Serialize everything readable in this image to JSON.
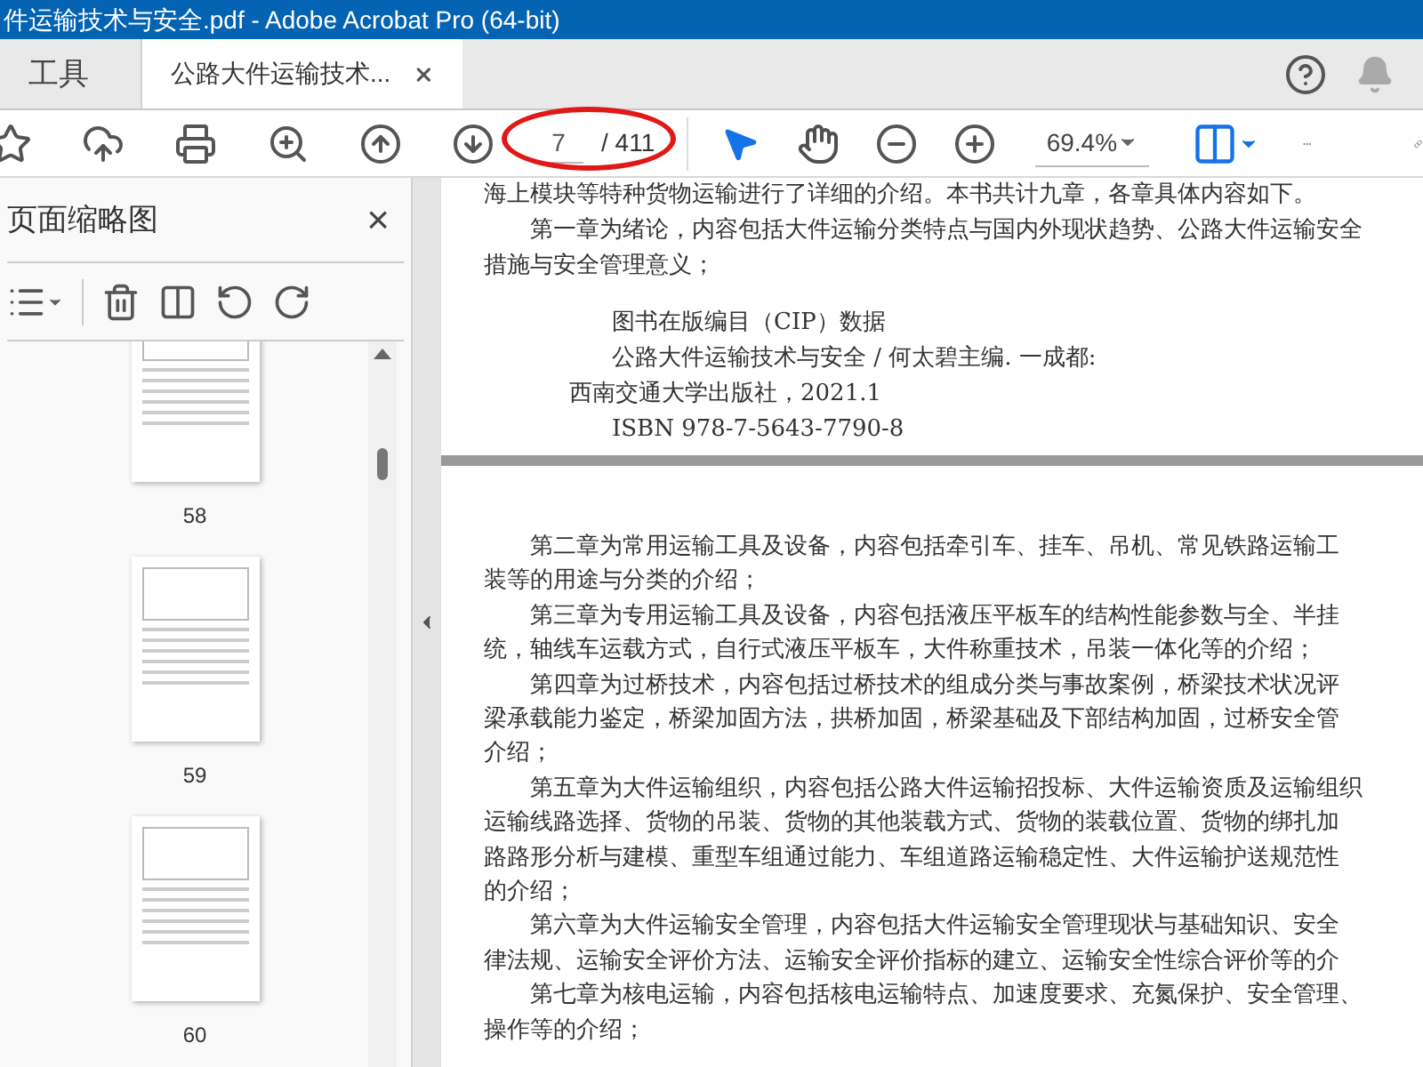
{
  "window": {
    "title": "件运输技术与安全.pdf - Adobe Acrobat Pro (64-bit)"
  },
  "tabs": [
    {
      "label": "工具",
      "selected": false,
      "closable": false
    },
    {
      "label": "公路大件运输技术...",
      "selected": true,
      "closable": true
    }
  ],
  "toolbar": {
    "page_current": "7",
    "page_total": "/ 411",
    "zoom": "69.4%",
    "annotation_circled": true,
    "tools": [
      {
        "kind": "select",
        "selected": true
      },
      {
        "kind": "hand",
        "selected": false
      }
    ]
  },
  "sidebar": {
    "title": "页面缩略图",
    "close": "×",
    "thumbnails": [
      {
        "label": "58",
        "selected": false
      },
      {
        "label": "59",
        "selected": false
      },
      {
        "label": "60",
        "selected": false
      }
    ]
  },
  "document": {
    "top_lines": [
      {
        "text": "海上模块等特种货物运输进行了详细的介绍。本书共计九章，各章具体内容如下。",
        "indent": false
      },
      {
        "text": "第一章为绪论，内容包括大件运输分类特点与国内外现状趋势、公路大件运输安全",
        "indent": true
      },
      {
        "text": "措施与安全管理意义；",
        "indent": false
      }
    ],
    "cip": [
      "图书在版编目（CIP）数据",
      "公路大件运输技术与安全 / 何太碧主编. 一成都:",
      "西南交通大学出版社，2021.1",
      "ISBN 978-7-5643-7790-8"
    ],
    "lines": [
      {
        "text": "第二章为常用运输工具及设备，内容包括牵引车、挂车、吊机、常见铁路运输工",
        "indent": true
      },
      {
        "text": "装等的用途与分类的介绍；",
        "indent": false
      },
      {
        "text": "第三章为专用运输工具及设备，内容包括液压平板车的结构性能参数与全、半挂",
        "indent": true
      },
      {
        "text": "统，轴线车运载方式，自行式液压平板车，大件称重技术，吊装一体化等的介绍；",
        "indent": false
      },
      {
        "text": "第四章为过桥技术，内容包括过桥技术的组成分类与事故案例，桥梁技术状况评",
        "indent": true
      },
      {
        "text": "梁承载能力鉴定，桥梁加固方法，拱桥加固，桥梁基础及下部结构加固，过桥安全管",
        "indent": false
      },
      {
        "text": "介绍；",
        "indent": false
      },
      {
        "text": "第五章为大件运输组织，内容包括公路大件运输招投标、大件运输资质及运输组织",
        "indent": true
      },
      {
        "text": "运输线路选择、货物的吊装、货物的其他装载方式、货物的装载位置、货物的绑扎加",
        "indent": false
      },
      {
        "text": "路路形分析与建模、重型车组通过能力、车组道路运输稳定性、大件运输护送规范性",
        "indent": false
      },
      {
        "text": "的介绍；",
        "indent": false
      },
      {
        "text": "第六章为大件运输安全管理，内容包括大件运输安全管理现状与基础知识、安全",
        "indent": true
      },
      {
        "text": "律法规、运输安全评价方法、运输安全评价指标的建立、运输安全性综合评价等的介",
        "indent": false
      },
      {
        "text": "第七章为核电运输，内容包括核电运输特点、加速度要求、充氮保护、安全管理、",
        "indent": true
      },
      {
        "text": "操作等的介绍；",
        "indent": false
      }
    ]
  }
}
